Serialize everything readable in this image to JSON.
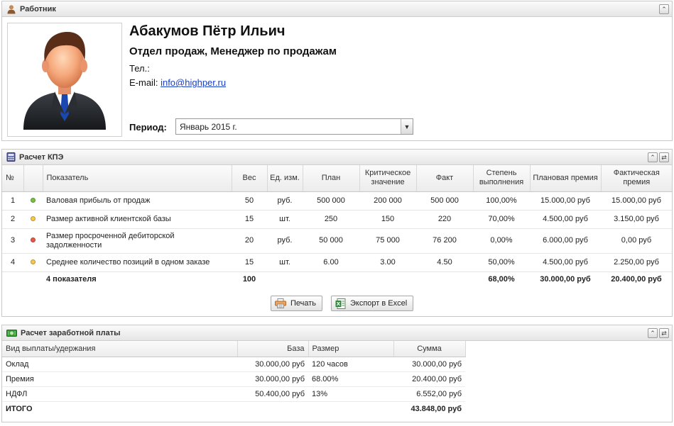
{
  "colors": {
    "status_green": "#7ac142",
    "status_yellow": "#f7c84a",
    "status_red": "#e55a4a",
    "link": "#1a3fbf",
    "total_weight": "#2a9d14"
  },
  "worker_panel": {
    "title": "Работник",
    "icon": "user-icon",
    "name": "Абакумов Пётр Ильич",
    "department": "Отдел продаж, Менеджер по продажам",
    "phone_label": "Тел.:",
    "email_label": "E-mail:",
    "email": "info@highper.ru",
    "period_label": "Период:",
    "period_value": "Январь 2015 г."
  },
  "kpi_panel": {
    "title": "Расчет КПЭ",
    "icon": "calculator-icon",
    "headers": [
      "№",
      "",
      "Показатель",
      "Вес",
      "Ед. изм.",
      "План",
      "Критическое значение",
      "Факт",
      "Степень выполнения",
      "Плановая премия",
      "Фактическая премия"
    ],
    "rows": [
      {
        "num": "1",
        "status": "green",
        "indicator": "Валовая прибыль от продаж",
        "weight": "50",
        "unit": "руб.",
        "plan": "500 000",
        "critical": "200 000",
        "fact": "500 000",
        "completion": "100,00%",
        "planned_bonus": "15.000,00 руб",
        "actual_bonus": "15.000,00 руб"
      },
      {
        "num": "2",
        "status": "yellow",
        "indicator": "Размер активной клиентской базы",
        "weight": "15",
        "unit": "шт.",
        "plan": "250",
        "critical": "150",
        "fact": "220",
        "completion": "70,00%",
        "planned_bonus": "4.500,00 руб",
        "actual_bonus": "3.150,00 руб"
      },
      {
        "num": "3",
        "status": "red",
        "indicator": "Размер просроченной дебиторской задолженности",
        "weight": "20",
        "unit": "руб.",
        "plan": "50 000",
        "critical": "75 000",
        "fact": "76 200",
        "completion": "0,00%",
        "planned_bonus": "6.000,00 руб",
        "actual_bonus": "0,00 руб"
      },
      {
        "num": "4",
        "status": "yellow",
        "indicator": "Среднее количество позиций в одном заказе",
        "weight": "15",
        "unit": "шт.",
        "plan": "6.00",
        "critical": "3.00",
        "fact": "4.50",
        "completion": "50,00%",
        "planned_bonus": "4.500,00 руб",
        "actual_bonus": "2.250,00 руб"
      }
    ],
    "total": {
      "label": "4 показателя",
      "weight": "100",
      "completion": "68,00%",
      "planned_bonus": "30.000,00 руб",
      "actual_bonus": "20.400,00 руб"
    },
    "print_label": "Печать",
    "export_label": "Экспорт в Excel"
  },
  "salary_panel": {
    "title": "Расчет заработной платы",
    "icon": "money-icon",
    "headers": [
      "Вид выплаты/удержания",
      "База",
      "Размер",
      "Сумма"
    ],
    "rows": [
      {
        "type": "Оклад",
        "base": "30.000,00 руб",
        "size": "120 часов",
        "sum": "30.000,00 руб"
      },
      {
        "type": "Премия",
        "base": "30.000,00 руб",
        "size": "68.00%",
        "sum": "20.400,00 руб"
      },
      {
        "type": "НДФЛ",
        "base": "50.400,00 руб",
        "size": "13%",
        "sum": "6.552,00 руб"
      }
    ],
    "total": {
      "label": "ИТОГО",
      "sum": "43.848,00 руб"
    }
  }
}
